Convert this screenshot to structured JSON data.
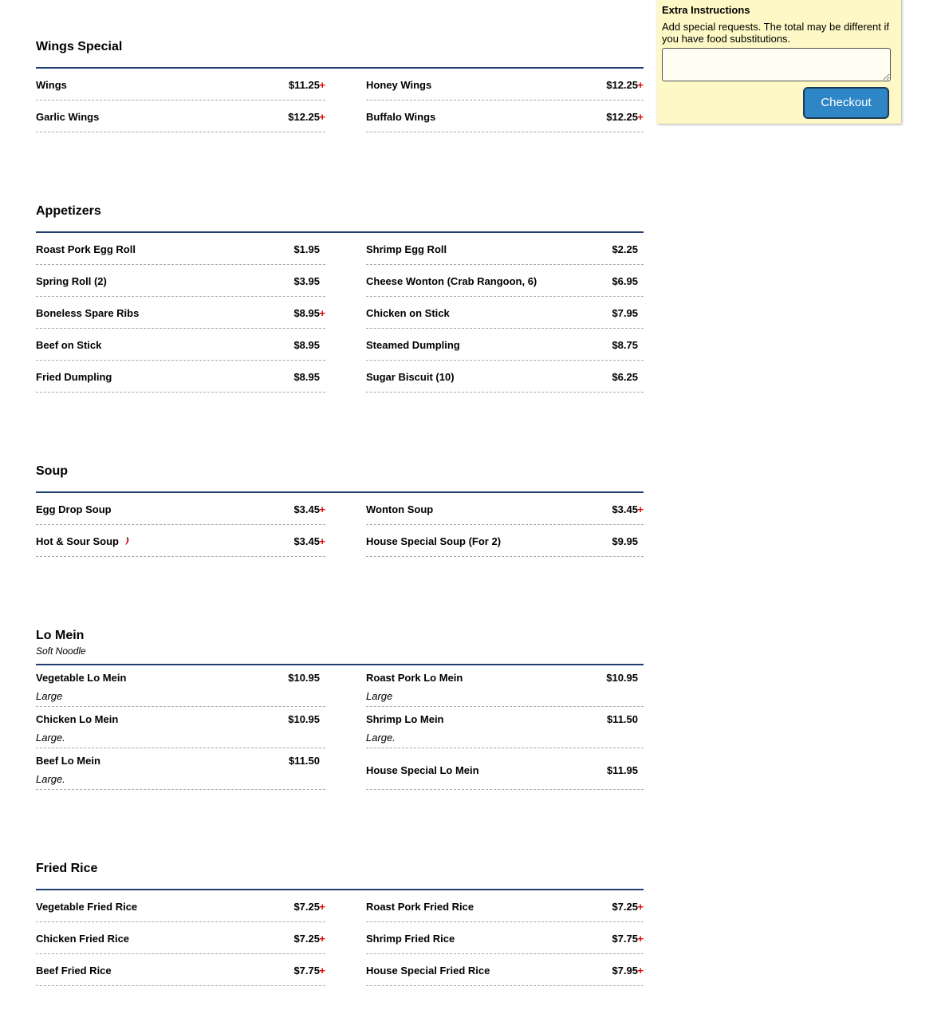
{
  "panel": {
    "title": "Extra Instructions",
    "note": "Add special requests. The total may be different if you have food substitutions.",
    "textarea_value": "",
    "checkout_label": "Checkout"
  },
  "plus_symbol": "+",
  "spicy_icon": "chili-pepper-icon",
  "colors": {
    "heading_rule": "#1f3d6e",
    "plus": "#e00000",
    "panel_bg": "#fdf8c5",
    "checkout_bg": "#2e86c7"
  },
  "sections": [
    {
      "title": "Wings Special",
      "subtitle": "",
      "items": [
        {
          "name": "Wings",
          "price": "$11.25",
          "plus": true
        },
        {
          "name": "Honey Wings",
          "price": "$12.25",
          "plus": true
        },
        {
          "name": "Garlic Wings",
          "price": "$12.25",
          "plus": true
        },
        {
          "name": "Buffalo Wings",
          "price": "$12.25",
          "plus": true
        }
      ]
    },
    {
      "title": "Appetizers",
      "subtitle": "",
      "items": [
        {
          "name": "Roast Pork Egg Roll",
          "price": "$1.95",
          "plus": false
        },
        {
          "name": "Shrimp Egg Roll",
          "price": "$2.25",
          "plus": false
        },
        {
          "name": "Spring Roll (2)",
          "price": "$3.95",
          "plus": false
        },
        {
          "name": "Cheese Wonton (Crab Rangoon, 6)",
          "price": "$6.95",
          "plus": false
        },
        {
          "name": "Boneless Spare Ribs",
          "price": "$8.95",
          "plus": true
        },
        {
          "name": "Chicken on Stick",
          "price": "$7.95",
          "plus": false
        },
        {
          "name": "Beef on Stick",
          "price": "$8.95",
          "plus": false
        },
        {
          "name": "Steamed Dumpling",
          "price": "$8.75",
          "plus": false
        },
        {
          "name": "Fried Dumpling",
          "price": "$8.95",
          "plus": false
        },
        {
          "name": "Sugar Biscuit (10)",
          "price": "$6.25",
          "plus": false
        }
      ]
    },
    {
      "title": "Soup",
      "subtitle": "",
      "items": [
        {
          "name": "Egg Drop Soup",
          "price": "$3.45",
          "plus": true
        },
        {
          "name": "Wonton Soup",
          "price": "$3.45",
          "plus": true
        },
        {
          "name": "Hot & Sour Soup",
          "price": "$3.45",
          "plus": true,
          "spicy": true
        },
        {
          "name": "House Special Soup (For 2)",
          "price": "$9.95",
          "plus": false
        }
      ]
    },
    {
      "title": "Lo Mein",
      "subtitle": "Soft Noodle",
      "tall": true,
      "items": [
        {
          "name": "Vegetable Lo Mein",
          "desc": "Large",
          "price": "$10.95",
          "plus": false
        },
        {
          "name": "Roast Pork Lo Mein",
          "desc": "Large",
          "price": "$10.95",
          "plus": false
        },
        {
          "name": "Chicken Lo Mein",
          "desc": "Large.",
          "price": "$10.95",
          "plus": false
        },
        {
          "name": "Shrimp Lo Mein",
          "desc": "Large.",
          "price": "$11.50",
          "plus": false
        },
        {
          "name": "Beef Lo Mein",
          "desc": "Large.",
          "price": "$11.50",
          "plus": false
        },
        {
          "name": "House Special Lo Mein",
          "desc": "",
          "price": "$11.95",
          "plus": false
        }
      ]
    },
    {
      "title": "Fried Rice",
      "subtitle": "",
      "items": [
        {
          "name": "Vegetable Fried Rice",
          "price": "$7.25",
          "plus": true
        },
        {
          "name": "Roast Pork Fried Rice",
          "price": "$7.25",
          "plus": true
        },
        {
          "name": "Chicken Fried Rice",
          "price": "$7.25",
          "plus": true
        },
        {
          "name": "Shrimp Fried Rice",
          "price": "$7.75",
          "plus": true
        },
        {
          "name": "Beef Fried Rice",
          "price": "$7.75",
          "plus": true
        },
        {
          "name": "House Special Fried Rice",
          "price": "$7.95",
          "plus": true
        }
      ]
    }
  ]
}
